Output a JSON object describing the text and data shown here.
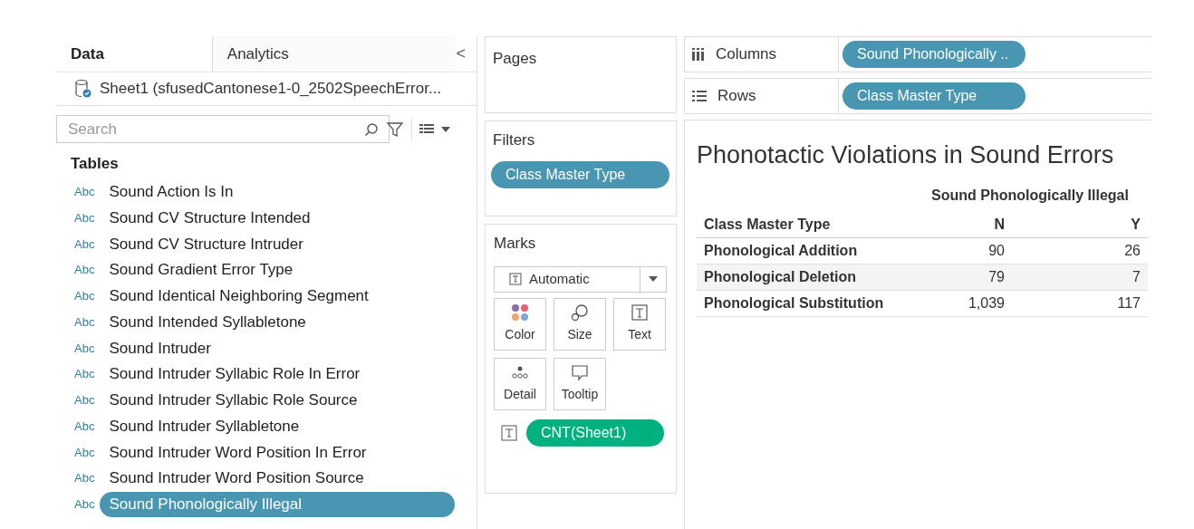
{
  "data_pane": {
    "tabs": [
      {
        "label": "Data",
        "selected": true
      },
      {
        "label": "Analytics",
        "selected": false
      }
    ],
    "collapse": "<",
    "datasource": "Sheet1 (sfusedCantonese1-0_2502SpeechError...",
    "search": {
      "placeholder": "Search"
    },
    "section": "Tables",
    "fields": [
      {
        "type_label": "Abc",
        "name": "Sound Action Is In",
        "selected": false
      },
      {
        "type_label": "Abc",
        "name": "Sound CV Structure Intended",
        "selected": false
      },
      {
        "type_label": "Abc",
        "name": "Sound CV Structure Intruder",
        "selected": false
      },
      {
        "type_label": "Abc",
        "name": "Sound Gradient Error Type",
        "selected": false
      },
      {
        "type_label": "Abc",
        "name": "Sound Identical Neighboring Segment",
        "selected": false
      },
      {
        "type_label": "Abc",
        "name": "Sound Intended Syllabletone",
        "selected": false
      },
      {
        "type_label": "Abc",
        "name": "Sound Intruder",
        "selected": false
      },
      {
        "type_label": "Abc",
        "name": "Sound Intruder Syllabic Role In Error",
        "selected": false
      },
      {
        "type_label": "Abc",
        "name": "Sound Intruder Syllabic Role Source",
        "selected": false
      },
      {
        "type_label": "Abc",
        "name": "Sound Intruder Syllabletone",
        "selected": false
      },
      {
        "type_label": "Abc",
        "name": "Sound Intruder Word Position In Error",
        "selected": false
      },
      {
        "type_label": "Abc",
        "name": "Sound Intruder Word Position Source",
        "selected": false
      },
      {
        "type_label": "Abc",
        "name": "Sound Phonologically Illegal",
        "selected": true
      }
    ]
  },
  "pages": {
    "title": "Pages"
  },
  "filters": {
    "title": "Filters",
    "pills": [
      {
        "label": "Class Master Type",
        "color": "#4996b2"
      }
    ]
  },
  "marks": {
    "title": "Marks",
    "mark_type": "Automatic",
    "cards": [
      {
        "kind": "color",
        "label": "Color"
      },
      {
        "kind": "size",
        "label": "Size"
      },
      {
        "kind": "text",
        "label": "Text"
      },
      {
        "kind": "detail",
        "label": "Detail"
      },
      {
        "kind": "tooltip",
        "label": "Tooltip"
      }
    ],
    "pills": [
      {
        "label": "CNT(Sheet1)",
        "color": "#00b180"
      }
    ]
  },
  "columns_shelf": {
    "label": "Columns",
    "pills": [
      {
        "label": "Sound Phonologically ..",
        "color": "#4996b2"
      }
    ]
  },
  "rows_shelf": {
    "label": "Rows",
    "pills": [
      {
        "label": "Class Master Type",
        "color": "#4996b2"
      }
    ]
  },
  "view": {
    "title": "Phonotactic Violations in Sound Errors",
    "column_group": "Sound Phonologically Illegal",
    "columns": [
      "Class Master Type",
      "N",
      "Y"
    ],
    "rows": [
      [
        "Phonological Addition",
        "90",
        "26"
      ],
      [
        "Phonological Deletion",
        "79",
        "7"
      ],
      [
        "Phonological Substitution",
        "1,039",
        "117"
      ]
    ]
  }
}
